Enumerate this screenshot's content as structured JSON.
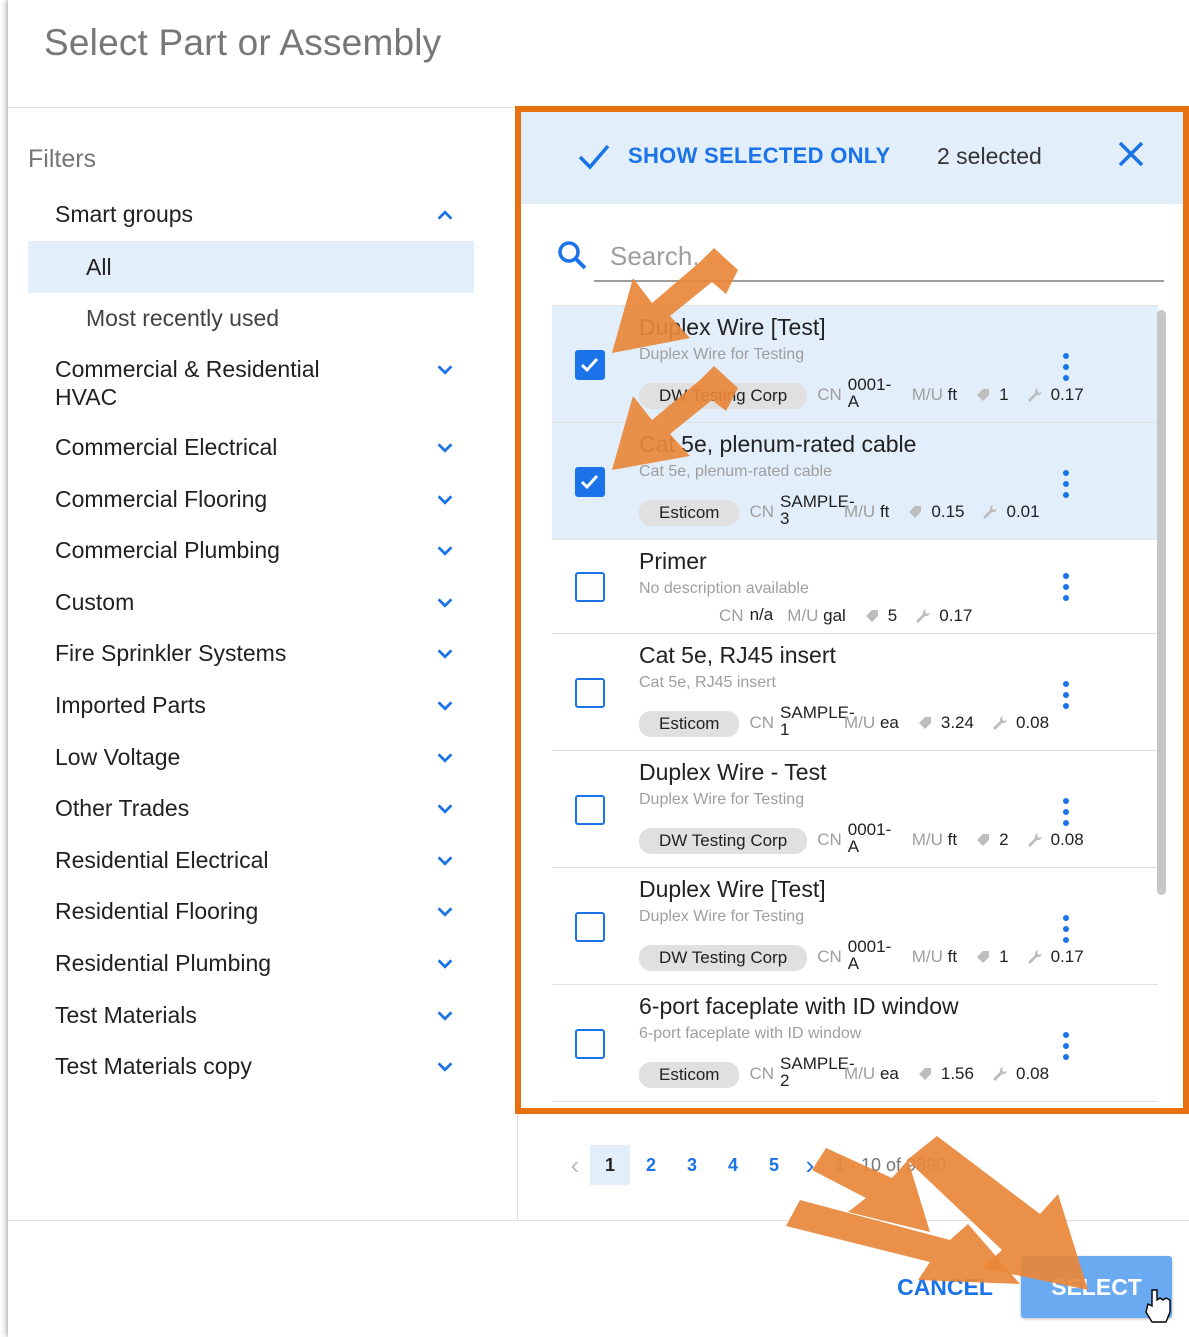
{
  "dialog": {
    "title": "Select Part or Assembly"
  },
  "filters": {
    "title": "Filters",
    "smart_groups": {
      "label": "Smart groups",
      "items": [
        {
          "label": "All",
          "active": true
        },
        {
          "label": "Most recently used",
          "active": false
        }
      ]
    },
    "groups": [
      "Commercial & Residential HVAC",
      "Commercial Electrical",
      "Commercial Flooring",
      "Commercial Plumbing",
      "Custom",
      "Fire Sprinkler Systems",
      "Imported Parts",
      "Low Voltage",
      "Other Trades",
      "Residential Electrical",
      "Residential Flooring",
      "Residential Plumbing",
      "Test Materials",
      "Test Materials copy"
    ]
  },
  "selection_bar": {
    "show_selected_label": "SHOW SELECTED ONLY",
    "count_label": "2 selected",
    "close_icon": "close-icon"
  },
  "search": {
    "placeholder": "Search...",
    "value": ""
  },
  "items": [
    {
      "name": "Duplex Wire [Test]",
      "description": "Duplex Wire for Testing",
      "vendor": "DW Testing Corp",
      "cn_label": "CN",
      "cn": "0001-A",
      "mu_label": "M/U",
      "mu": "ft",
      "price": "1",
      "labor": "0.17",
      "selected": true
    },
    {
      "name": "Cat 5e, plenum-rated cable",
      "description": "Cat 5e, plenum-rated cable",
      "vendor": "Esticom",
      "cn_label": "CN",
      "cn": "SAMPLE-3",
      "mu_label": "M/U",
      "mu": "ft",
      "price": "0.15",
      "labor": "0.01",
      "selected": true
    },
    {
      "name": "Primer",
      "description": "No description available",
      "vendor": "",
      "cn_label": "CN",
      "cn": "n/a",
      "mu_label": "M/U",
      "mu": "gal",
      "price": "5",
      "labor": "0.17",
      "selected": false
    },
    {
      "name": "Cat 5e, RJ45 insert",
      "description": "Cat 5e, RJ45 insert",
      "vendor": "Esticom",
      "cn_label": "CN",
      "cn": "SAMPLE-1",
      "mu_label": "M/U",
      "mu": "ea",
      "price": "3.24",
      "labor": "0.08",
      "selected": false
    },
    {
      "name": "Duplex Wire - Test",
      "description": "Duplex Wire for Testing",
      "vendor": "DW Testing Corp",
      "cn_label": "CN",
      "cn": "0001-A",
      "mu_label": "M/U",
      "mu": "ft",
      "price": "2",
      "labor": "0.08",
      "selected": false
    },
    {
      "name": "Duplex Wire [Test]",
      "description": "Duplex Wire for Testing",
      "vendor": "DW Testing Corp",
      "cn_label": "CN",
      "cn": "0001-A",
      "mu_label": "M/U",
      "mu": "ft",
      "price": "1",
      "labor": "0.17",
      "selected": false
    },
    {
      "name": "6-port faceplate with ID window",
      "description": "6-port faceplate with ID window",
      "vendor": "Esticom",
      "cn_label": "CN",
      "cn": "SAMPLE-2",
      "mu_label": "M/U",
      "mu": "ea",
      "price": "1.56",
      "labor": "0.08",
      "selected": false
    }
  ],
  "pagination": {
    "pages": [
      "1",
      "2",
      "3",
      "4",
      "5"
    ],
    "current": "1",
    "range": "1 - 10 of 9890"
  },
  "footer": {
    "cancel_label": "CANCEL",
    "select_label": "SELECT"
  },
  "colors": {
    "accent": "#1a73e8",
    "highlight": "#e3eefb",
    "annotation_frame": "#e8700f",
    "annotation_arrow": "#e8873a"
  }
}
